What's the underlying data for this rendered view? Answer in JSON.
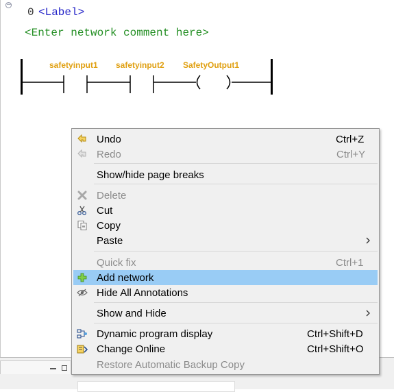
{
  "editor": {
    "network_number": "0",
    "network_label": "<Label>",
    "network_comment": "<Enter network comment here>",
    "contacts": [
      "safetyinput1",
      "safetyinput2"
    ],
    "coil": "SafetyOutput1"
  },
  "menu": {
    "undo": {
      "label": "Undo",
      "shortcut": "Ctrl+Z"
    },
    "redo": {
      "label": "Redo",
      "shortcut": "Ctrl+Y"
    },
    "page_breaks": {
      "label": "Show/hide page breaks"
    },
    "delete": {
      "label": "Delete"
    },
    "cut": {
      "label": "Cut"
    },
    "copy": {
      "label": "Copy"
    },
    "paste": {
      "label": "Paste"
    },
    "quick_fix": {
      "label": "Quick fix",
      "shortcut": "Ctrl+1"
    },
    "add_network": {
      "label": "Add network"
    },
    "hide_annotations": {
      "label": "Hide All Annotations"
    },
    "show_hide": {
      "label": "Show and Hide"
    },
    "dynamic_display": {
      "label": "Dynamic program display",
      "shortcut": "Ctrl+Shift+D"
    },
    "change_online": {
      "label": "Change Online",
      "shortcut": "Ctrl+Shift+O"
    },
    "restore_backup": {
      "label": "Restore Automatic Backup Copy"
    }
  },
  "colors": {
    "highlight": "#99ccf5",
    "label_blue": "#2323c8",
    "comment_green": "#248f24",
    "variable_orange": "#e0a012"
  }
}
